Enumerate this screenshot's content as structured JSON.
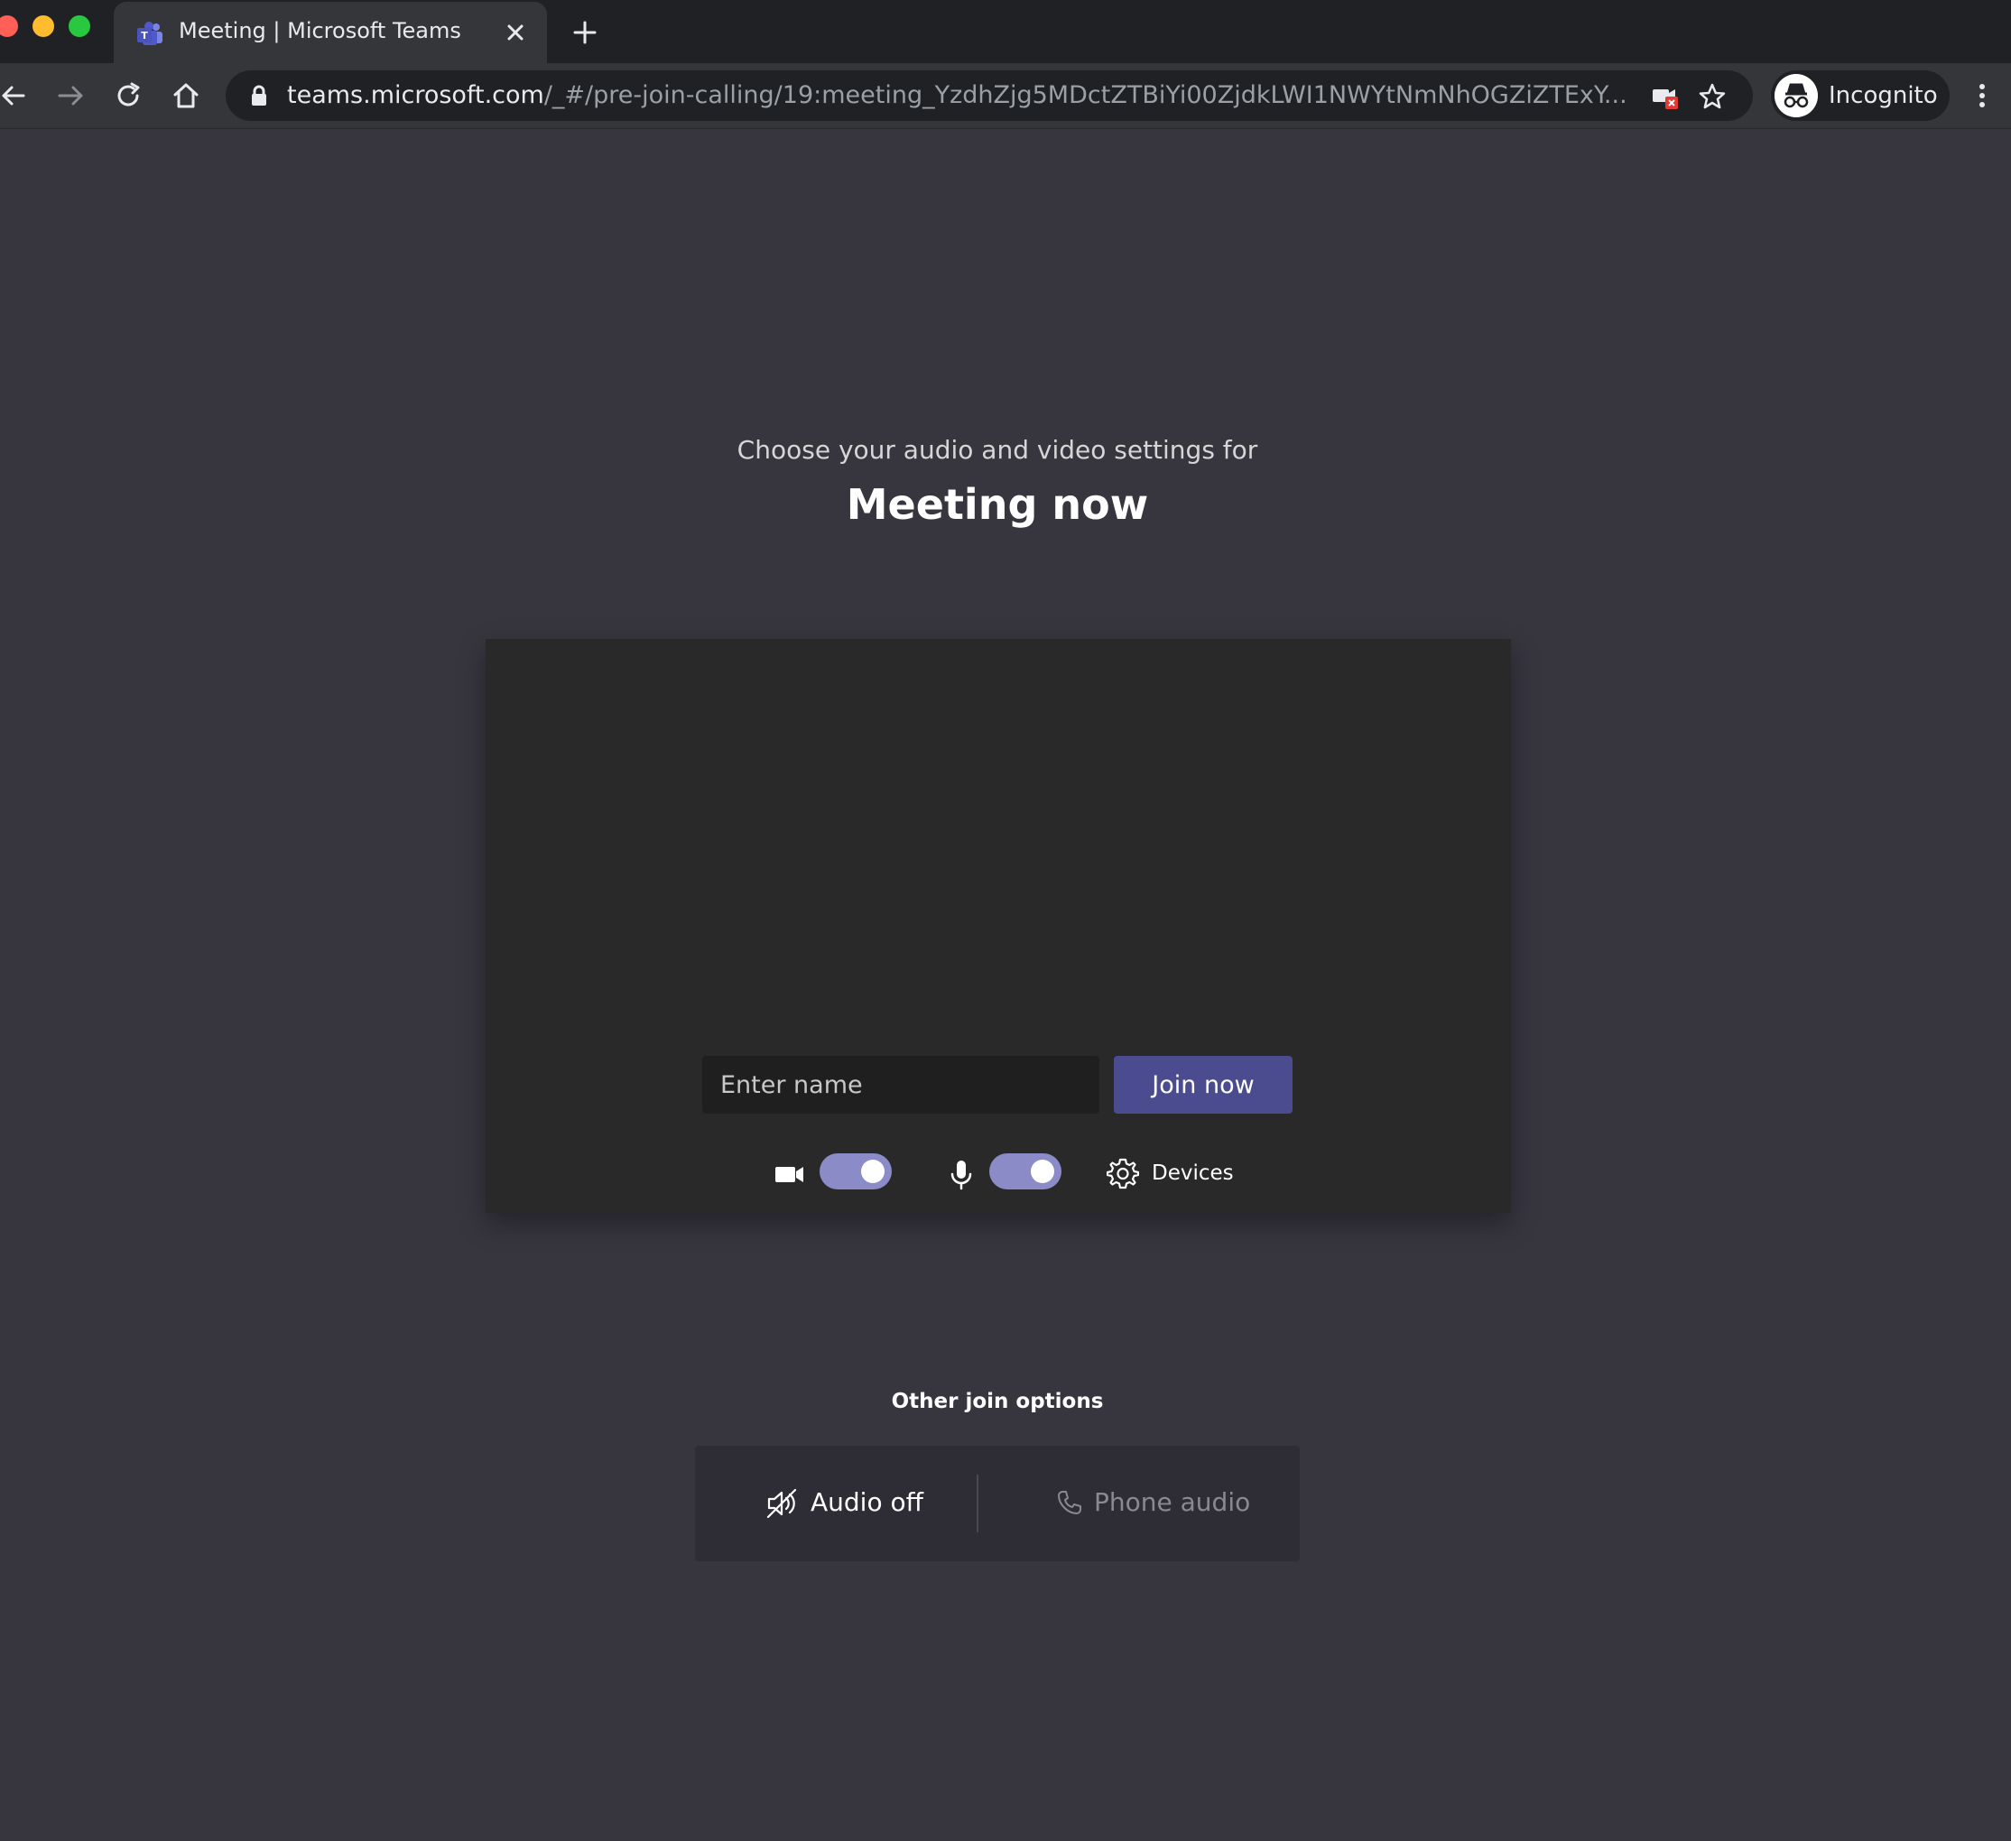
{
  "browser": {
    "tab_title": "Meeting | Microsoft Teams",
    "url_host": "teams.microsoft.com",
    "url_path": "/_#/pre-join-calling/19:meeting_YzdhZjg5MDctZTBiYi00ZjdkLWI1NWYtNmNhOGZiZTExY...",
    "profile_label": "Incognito"
  },
  "prejoin": {
    "subtitle": "Choose your audio and video settings for",
    "meeting_title": "Meeting now",
    "name_placeholder": "Enter name",
    "join_label": "Join now",
    "camera_on": true,
    "mic_on": true,
    "devices_label": "Devices"
  },
  "other_options": {
    "heading": "Other join options",
    "audio_off_label": "Audio off",
    "phone_audio_label": "Phone audio"
  },
  "colors": {
    "page_bg": "#37363f",
    "accent": "#4b4b8f",
    "toggle_on": "#8b8cc7"
  }
}
